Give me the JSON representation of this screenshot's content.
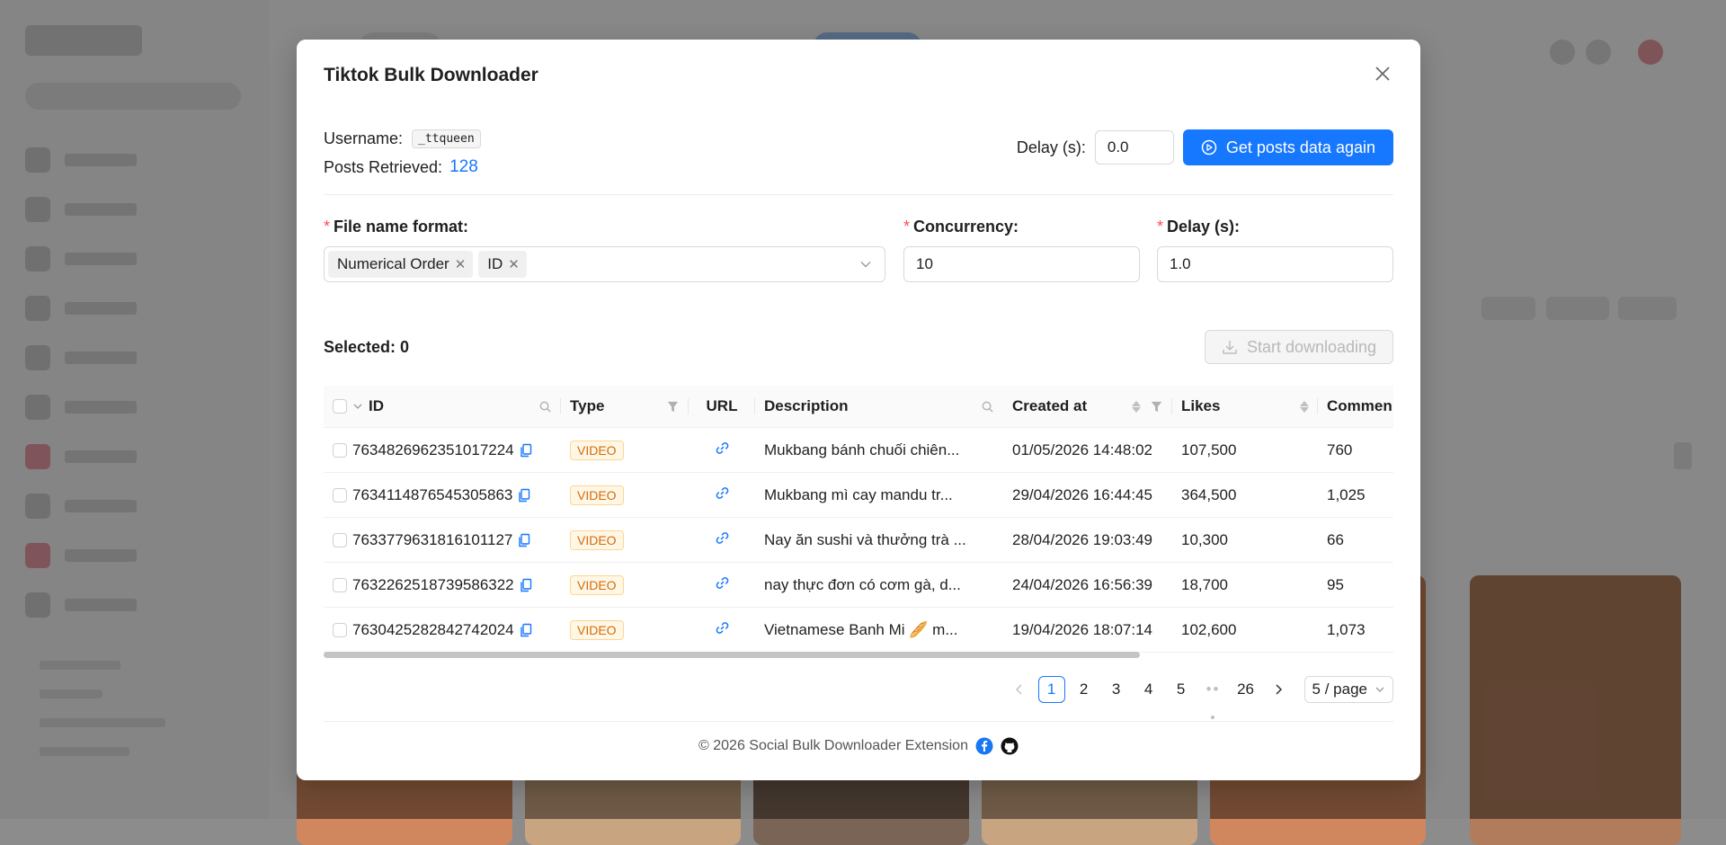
{
  "modal": {
    "title": "Tiktok Bulk Downloader",
    "username_label": "Username:",
    "username": "_ttqueen",
    "posts_label": "Posts Retrieved:",
    "posts_count": "128",
    "top_delay_label": "Delay (s):",
    "top_delay_value": "0.0",
    "refetch_button": "Get posts data again"
  },
  "form": {
    "file_name_label": "File name format:",
    "file_name_tags": [
      "Numerical Order",
      "ID"
    ],
    "concurrency_label": "Concurrency:",
    "concurrency_value": "10",
    "delay_label": "Delay (s):",
    "delay_value": "1.0"
  },
  "selection": {
    "selected_label": "Selected: 0",
    "start_button": "Start downloading"
  },
  "table": {
    "headers": {
      "id": "ID",
      "type": "Type",
      "url": "URL",
      "description": "Description",
      "created": "Created at",
      "likes": "Likes",
      "comments": "Commen"
    },
    "rows": [
      {
        "id": "7634826962351017224",
        "type": "VIDEO",
        "description": "Mukbang bánh chuối chiên...",
        "created": "01/05/2026 14:48:02",
        "likes": "107,500",
        "comments": "760"
      },
      {
        "id": "7634114876545305863",
        "type": "VIDEO",
        "description": "Mukbang mì cay mandu tr...",
        "created": "29/04/2026 16:44:45",
        "likes": "364,500",
        "comments": "1,025"
      },
      {
        "id": "7633779631816101127",
        "type": "VIDEO",
        "description": "Nay ăn sushi và thưởng trà ...",
        "created": "28/04/2026 19:03:49",
        "likes": "10,300",
        "comments": "66"
      },
      {
        "id": "7632262518739586322",
        "type": "VIDEO",
        "description": "nay thực đơn có cơm gà, d...",
        "created": "24/04/2026 16:56:39",
        "likes": "18,700",
        "comments": "95"
      },
      {
        "id": "7630425282842742024",
        "type": "VIDEO",
        "description": "Vietnamese Banh Mi 🥖 m...",
        "created": "19/04/2026 18:07:14",
        "likes": "102,600",
        "comments": "1,073"
      }
    ]
  },
  "pagination": {
    "pages": [
      "1",
      "2",
      "3",
      "4",
      "5"
    ],
    "ellipsis": "••",
    "last": "26",
    "current": "1",
    "page_size": "5 / page"
  },
  "footer": {
    "text": "© 2026 Social Bulk Downloader Extension"
  },
  "colors": {
    "primary": "#1677ff",
    "required": "#ff4d4f",
    "video_tag": "#d46b08"
  }
}
